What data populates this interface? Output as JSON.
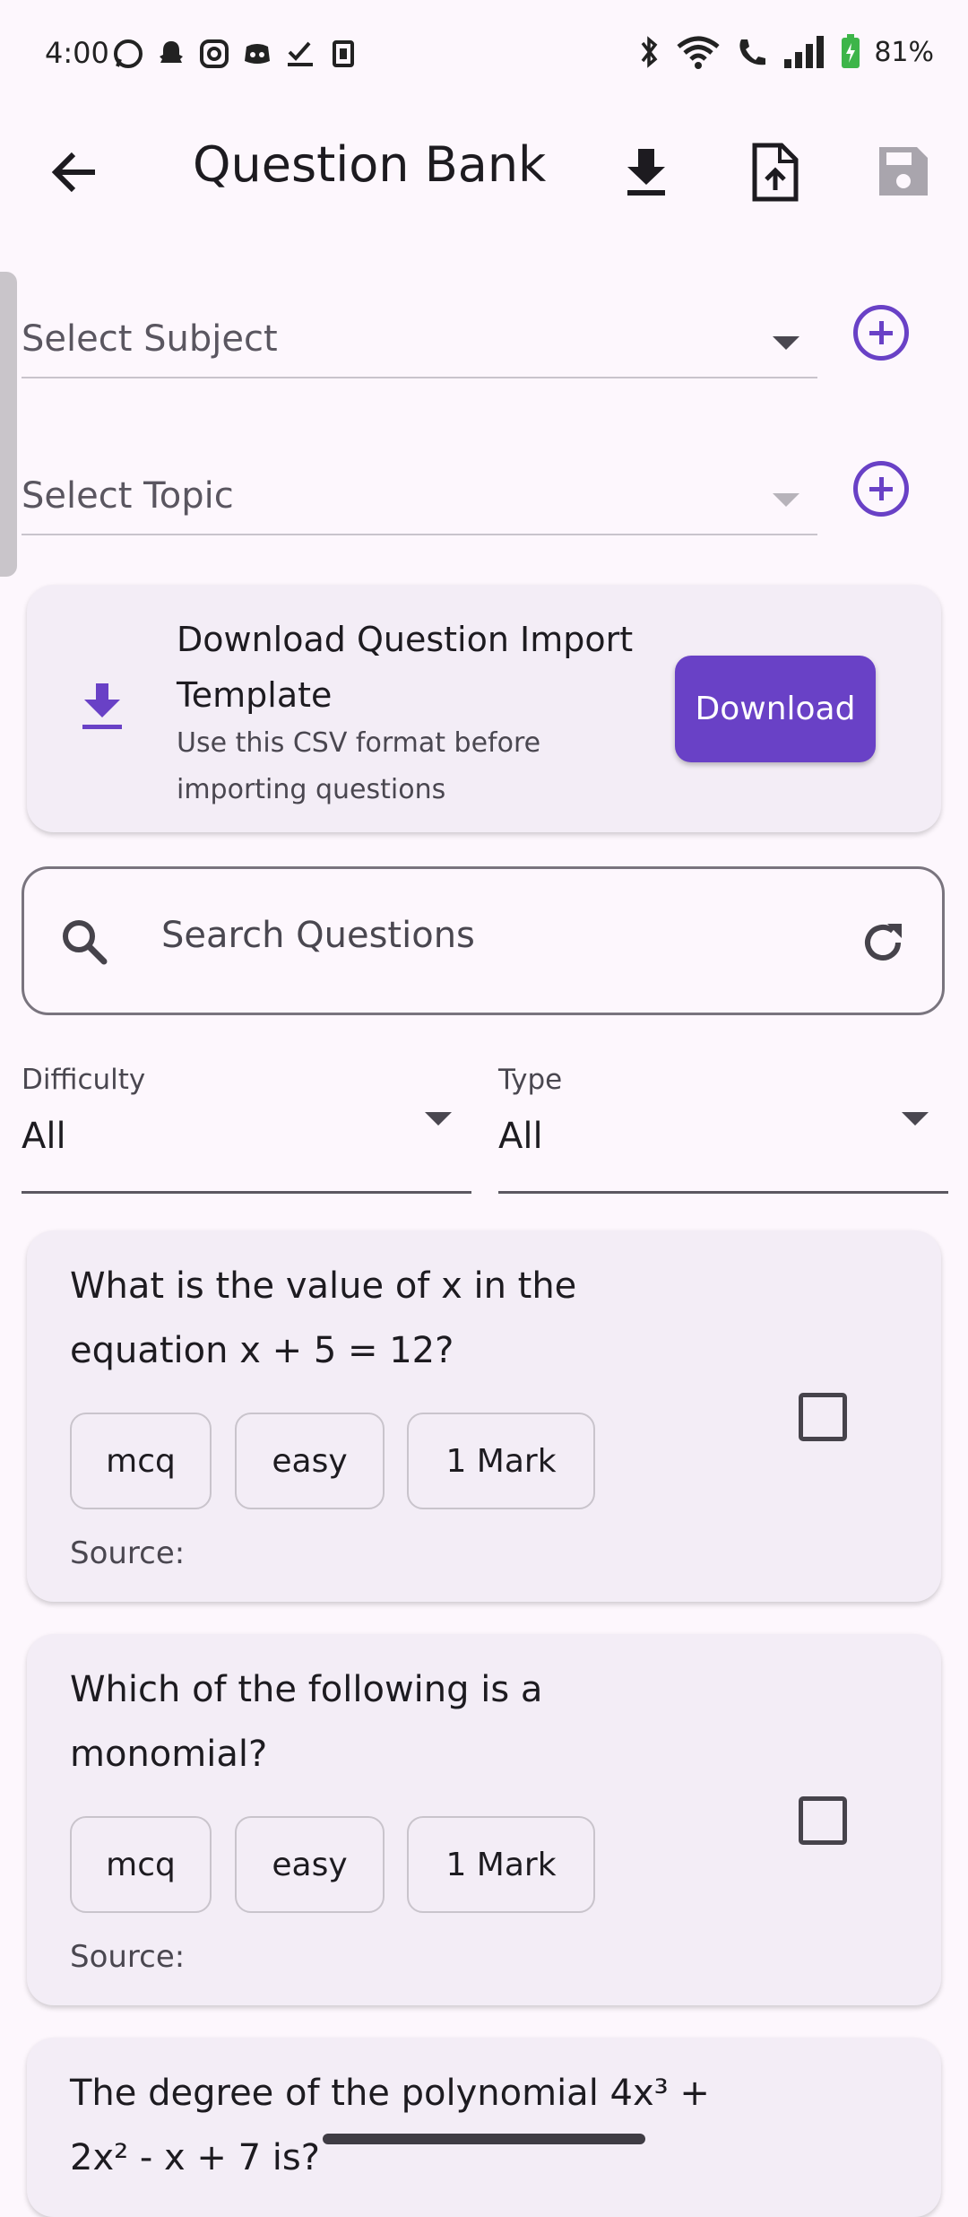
{
  "status_bar": {
    "time": "4:00",
    "battery": "81%"
  },
  "app_bar": {
    "title": "Question Bank"
  },
  "selects": {
    "subject_placeholder": "Select Subject",
    "topic_placeholder": "Select Topic"
  },
  "template_card": {
    "title": "Download Question Import Template",
    "subtitle": "Use this CSV format before importing questions",
    "button_label": "Download"
  },
  "search": {
    "placeholder": "Search Questions"
  },
  "filters": {
    "difficulty": {
      "label": "Difficulty",
      "value": "All"
    },
    "type": {
      "label": "Type",
      "value": "All"
    }
  },
  "questions": [
    {
      "text": "What is the value of x in the equation x + 5 = 12?",
      "chips": [
        "mcq",
        "easy",
        "1 Mark"
      ],
      "source": "Source:"
    },
    {
      "text": "Which of the following is a monomial?",
      "chips": [
        "mcq",
        "easy",
        "1 Mark"
      ],
      "source": "Source:"
    },
    {
      "text": "The degree of the polynomial 4x³ + 2x² - x + 7 is?"
    }
  ],
  "colors": {
    "accent": "#6941c6",
    "background": "#fdf7fd",
    "card": "#f3edf6"
  }
}
